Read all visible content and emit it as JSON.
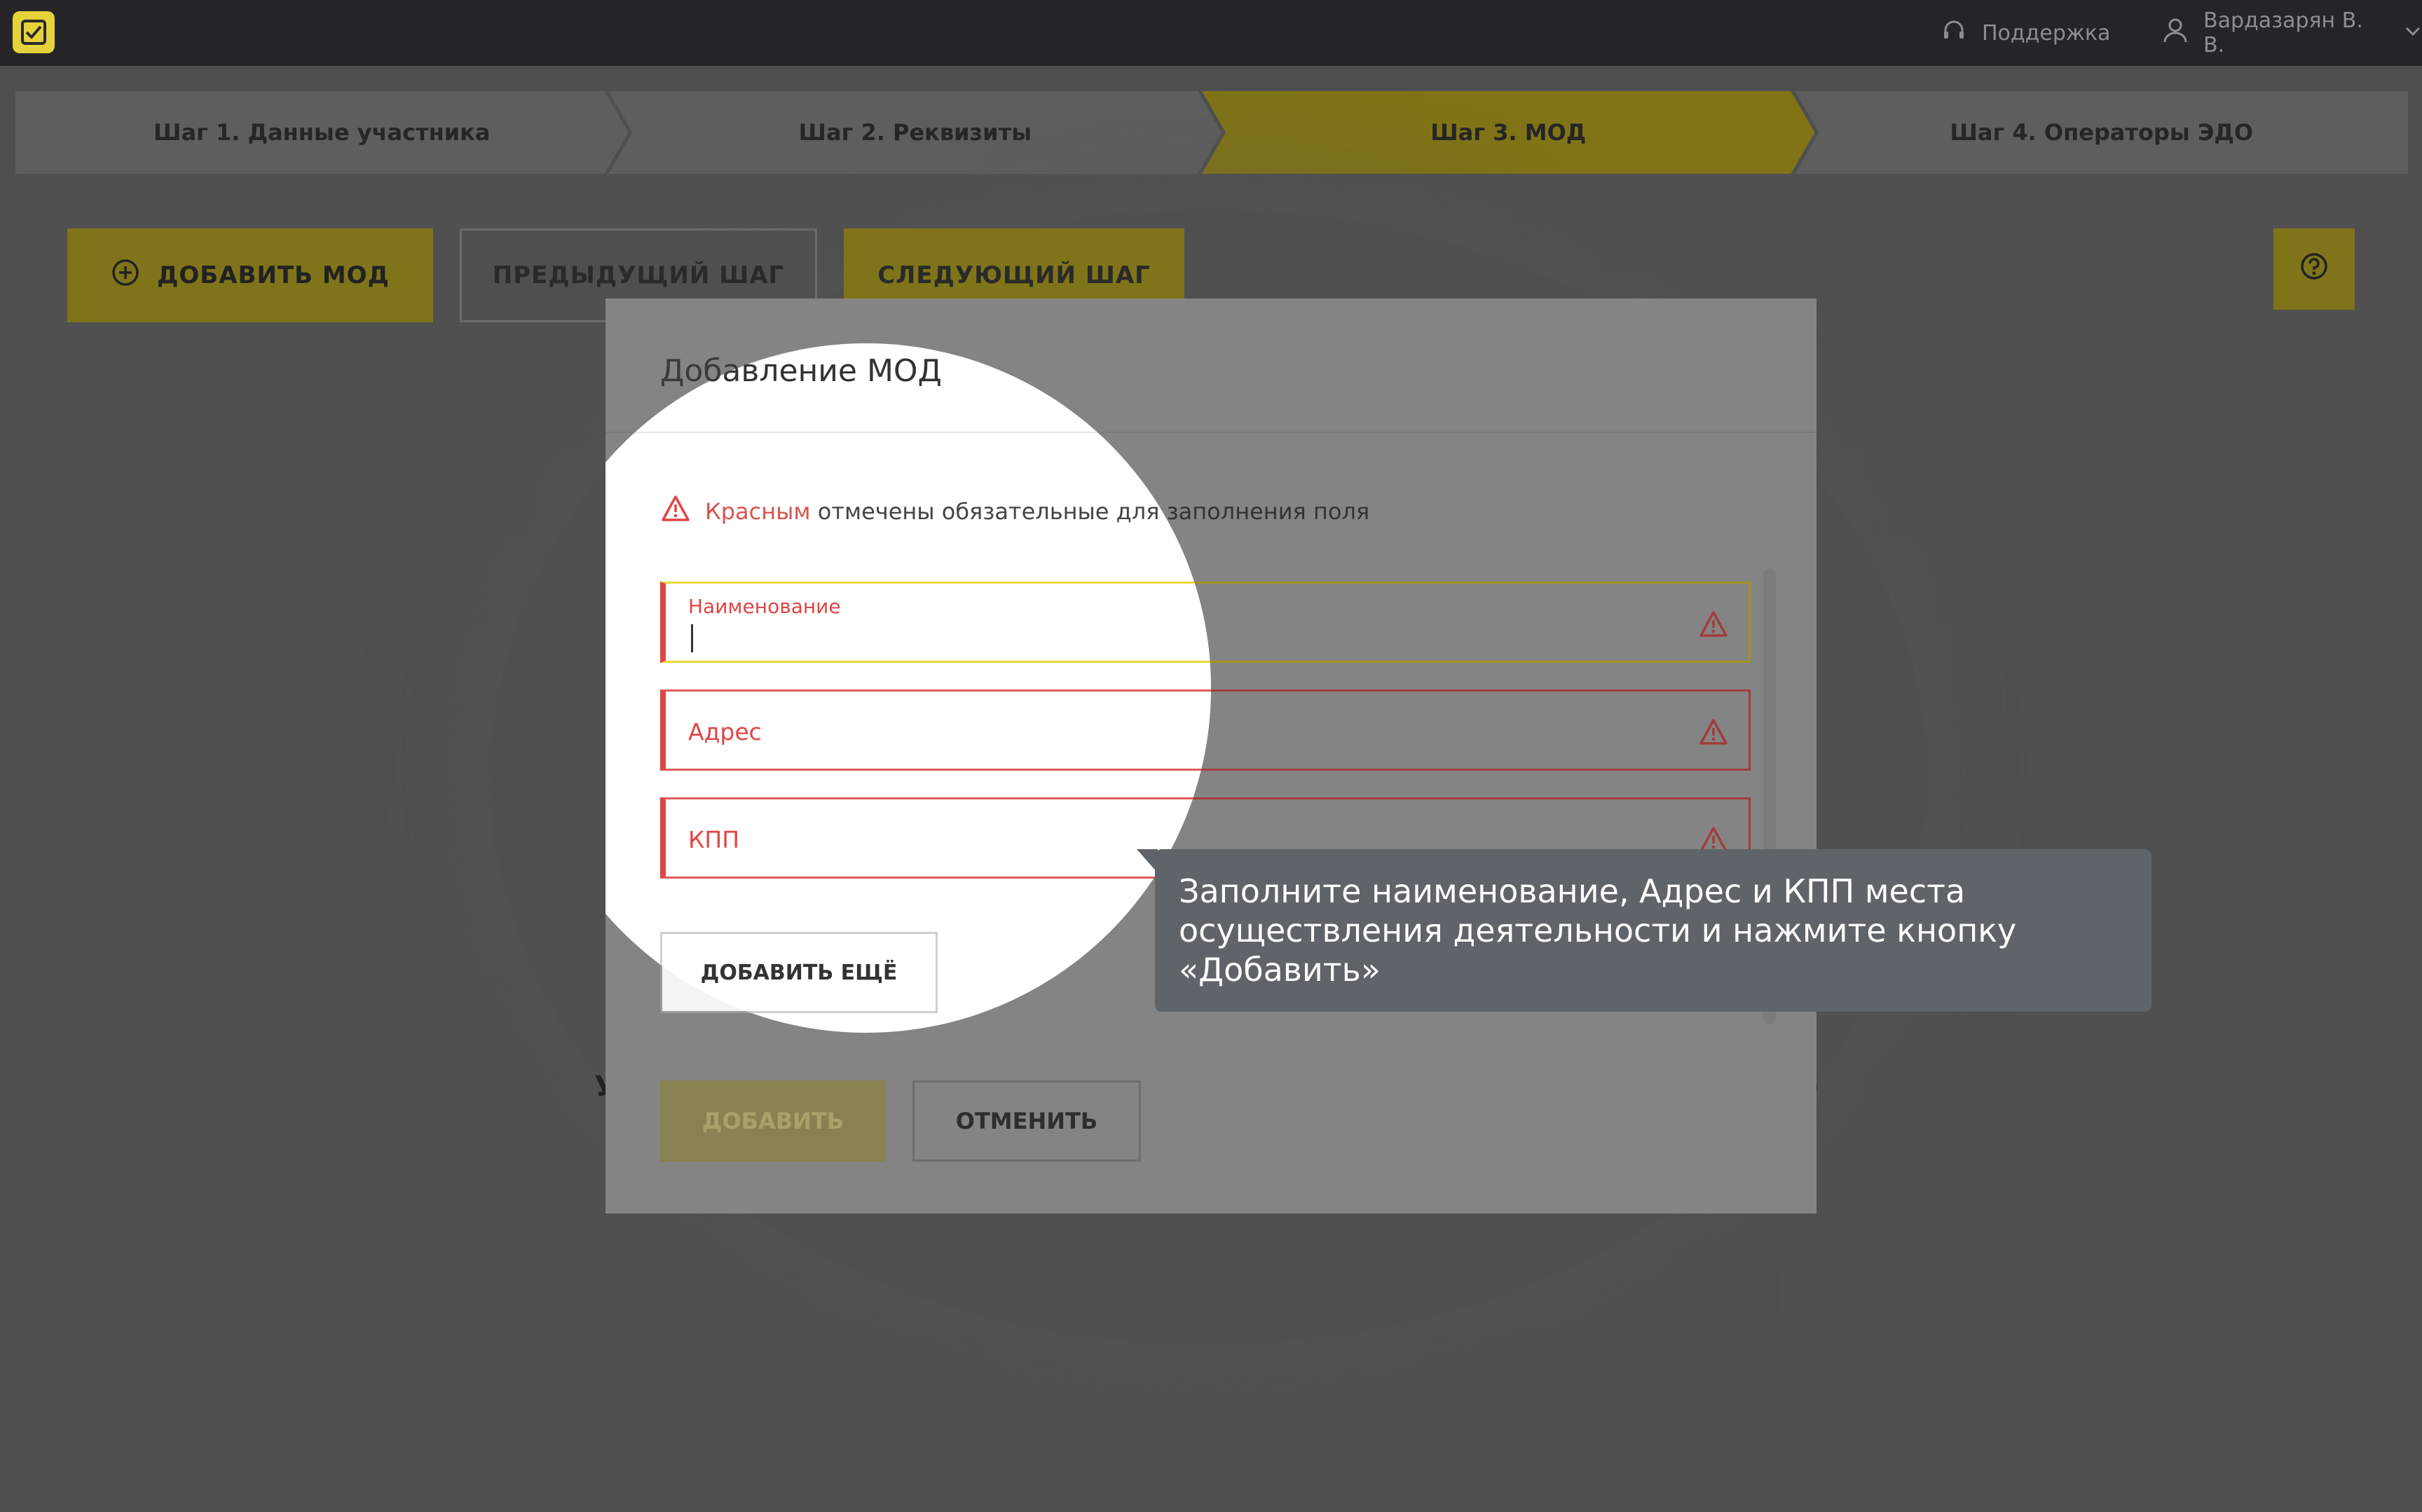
{
  "topbar": {
    "support_label": "Поддержка",
    "user_name": "Вардазарян В. В."
  },
  "steps": [
    {
      "label": "Шаг 1. Данные участника"
    },
    {
      "label": "Шаг 2. Реквизиты"
    },
    {
      "label": "Шаг 3. МОД"
    },
    {
      "label": "Шаг 4. Операторы ЭДО"
    }
  ],
  "page": {
    "add_mod_label": "ДОБАВИТЬ МОД",
    "prev_label": "ПРЕДЫДУЩИЙ ШАГ",
    "next_label": "СЛЕДУЮЩИЙ ШАГ",
    "bg_text_left": "У",
    "bg_text_right": ")"
  },
  "modal": {
    "title": "Добавление МОД",
    "note_red": "Красным",
    "note_rest": "отмечены обязательные для заполнения поля",
    "fields": [
      {
        "label": "Наименование",
        "value": ""
      },
      {
        "label": "Адрес",
        "value": ""
      },
      {
        "label": "КПП",
        "value": ""
      }
    ],
    "add_more_label": "ДОБАВИТЬ ЕЩЁ",
    "submit_label": "ДОБАВИТЬ",
    "cancel_label": "ОТМЕНИТЬ"
  },
  "tooltip": {
    "text": "Заполните наименование, Адрес и КПП места осуществления деятельности и нажмите кнопку «Добавить»"
  },
  "colors": {
    "accent": "#e6d23a",
    "error": "#e04545",
    "overlay": "#4f4f4f",
    "tooltip": "#5f646b"
  },
  "icons": [
    "logo-icon",
    "headset-icon",
    "user-icon",
    "chevron-down-icon",
    "plus-circle-icon",
    "help-icon",
    "warning-icon"
  ]
}
